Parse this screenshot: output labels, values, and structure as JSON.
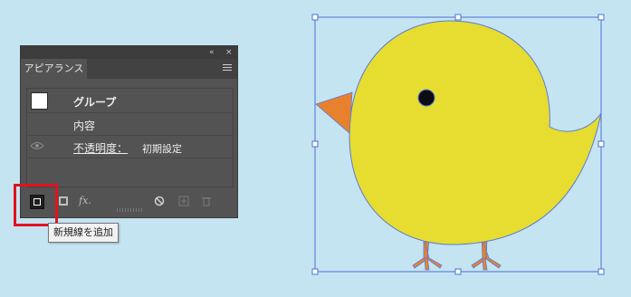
{
  "panel": {
    "collapse_icon": "«",
    "close_icon": "×",
    "tab_label": "アピアランス",
    "rows": [
      {
        "label": "グループ"
      },
      {
        "label": "内容"
      },
      {
        "label": "不透明度：",
        "value": "初期設定"
      }
    ],
    "footer": {
      "fx_label": "fx.",
      "icons": [
        "new-stroke-icon",
        "new-fill-icon",
        "fx-icon",
        "clear-appearance-icon",
        "duplicate-item-icon",
        "delete-item-icon"
      ]
    }
  },
  "tooltip": {
    "text": "新規線を追加"
  },
  "colors": {
    "canvas_bg": "#c5e4f2",
    "chick_body": "#e6dd30",
    "chick_beak": "#e8812e",
    "chick_legs": "#e8812e",
    "selection": "#4d6fd6",
    "highlight": "#e1131e"
  }
}
